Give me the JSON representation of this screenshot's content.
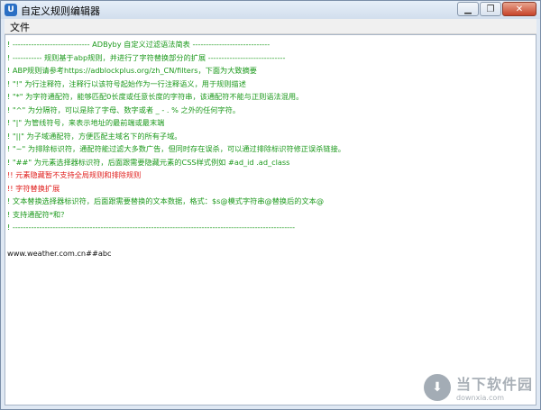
{
  "window": {
    "title": "自定义规则编辑器",
    "app_icon_glyph": "U",
    "minimize_icon": "minimize-icon",
    "restore_icon": "restore-icon",
    "close_icon": "close-icon"
  },
  "menu": {
    "items": [
      {
        "label": "文件"
      }
    ]
  },
  "editor": {
    "lines": [
      {
        "text": "! ----------------------------- ADByby 自定义过滤语法简表 -----------------------------",
        "color": "green"
      },
      {
        "text": "! ----------- 规则基于abp规则，并进行了字符替换部分的扩展 -----------------------------",
        "color": "green"
      },
      {
        "text": "! ABP规则请参考https://adblockplus.org/zh_CN/filters，下面为大致摘要",
        "color": "green"
      },
      {
        "text": "! \"!\" 为行注释符，注释行以该符号起始作为一行注释语义，用于规则描述",
        "color": "green"
      },
      {
        "text": "! \"*\" 为字符通配符，能够匹配0长度或任意长度的字符串，该通配符不能与正则语法混用。",
        "color": "green"
      },
      {
        "text": "! \"^\" 为分隔符，可以是除了字母、数字或者 _ - . % 之外的任何字符。",
        "color": "green"
      },
      {
        "text": "! \"|\" 为管线符号，来表示地址的最前端或最末端",
        "color": "green"
      },
      {
        "text": "! \"||\" 为子域通配符，方便匹配主域名下的所有子域。",
        "color": "green"
      },
      {
        "text": "! \"~\" 为排除标识符，通配符能过滤大多数广告，但同时存在误杀，可以通过排除标识符修正误杀链接。",
        "color": "green"
      },
      {
        "text": "! \"##\" 为元素选择器标识符，后面跟需要隐藏元素的CSS样式例如 #ad_id .ad_class",
        "color": "green"
      },
      {
        "text": "!! 元素隐藏暂不支持全局规则和排除规则",
        "color": "red"
      },
      {
        "text": "!! 字符替换扩展",
        "color": "red"
      },
      {
        "text": "! 文本替换选择器标识符，后面跟需要替换的文本数据，格式：$s@模式字符串@替换后的文本@",
        "color": "green"
      },
      {
        "text": "! 支持通配符*和？",
        "color": "green"
      },
      {
        "text": "! ----------------------------------------------------------------------------------------------------------",
        "color": "green"
      },
      {
        "text": "",
        "color": "black"
      },
      {
        "text": "www.weather.com.cn##abc",
        "color": "black"
      }
    ]
  },
  "watermark": {
    "cn": "当下软件园",
    "en": "downxia.com"
  },
  "colors": {
    "comment_green": "#1d9a1d",
    "comment_red": "#e0201e",
    "text_black": "#111111"
  }
}
